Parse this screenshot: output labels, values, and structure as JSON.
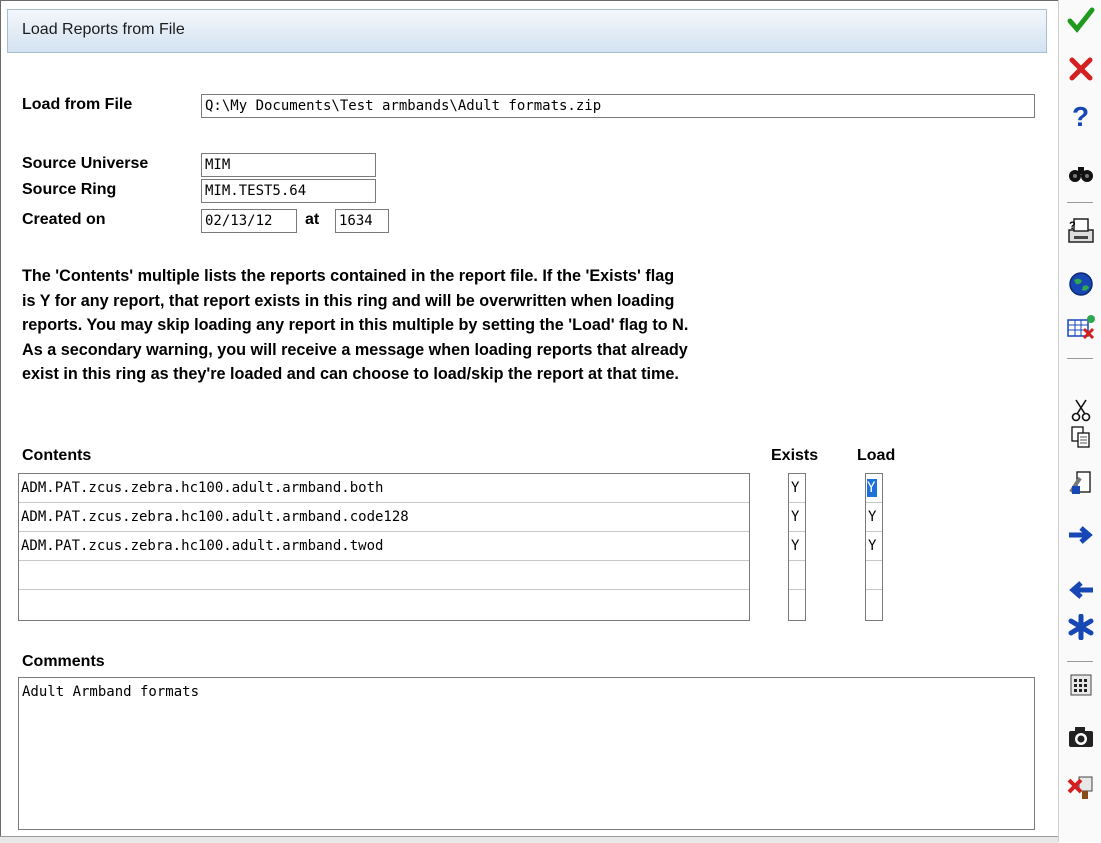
{
  "window": {
    "title": "Load Reports from File"
  },
  "form": {
    "load_from_file_label": "Load from File",
    "load_from_file_value": "Q:\\My Documents\\Test armbands\\Adult formats.zip",
    "source_universe_label": "Source Universe",
    "source_universe_value": "MIM",
    "source_ring_label": "Source Ring",
    "source_ring_value": "MIM.TEST5.64",
    "created_on_label": "Created on",
    "created_on_date": "02/13/12",
    "at_label": "at",
    "created_on_time": "1634"
  },
  "description": [
    "The 'Contents' multiple lists the reports contained in the report file. If the 'Exists' flag",
    "is Y for any report, that report exists in this ring and will be overwritten when loading",
    "reports. You may skip loading any report in this multiple by setting the 'Load' flag to N.",
    "As a secondary warning, you will receive a message when loading reports that already",
    "exist in this ring as they're loaded and can choose to load/skip the report at that time."
  ],
  "contents": {
    "header": "Contents",
    "exists_header": "Exists",
    "load_header": "Load",
    "rows": [
      {
        "name": "ADM.PAT.zcus.zebra.hc100.adult.armband.both",
        "exists": "Y",
        "load": "Y"
      },
      {
        "name": "ADM.PAT.zcus.zebra.hc100.adult.armband.code128",
        "exists": "Y",
        "load": "Y"
      },
      {
        "name": "ADM.PAT.zcus.zebra.hc100.adult.armband.twod",
        "exists": "Y",
        "load": "Y"
      },
      {
        "name": "",
        "exists": "",
        "load": ""
      },
      {
        "name": "",
        "exists": "",
        "load": ""
      }
    ]
  },
  "comments": {
    "header": "Comments",
    "value": "Adult Armband formats"
  },
  "toolbar": {
    "icons": [
      "check-icon",
      "cancel-x-icon",
      "help-icon",
      "binoculars-icon",
      "print-icon",
      "globe-icon",
      "table-icon",
      "cut-icon",
      "copy-icon",
      "paste-icon",
      "arrow-right-icon",
      "arrow-left-icon",
      "asterisk-icon",
      "keypad-icon",
      "camera-icon",
      "exit-icon"
    ],
    "colors": {
      "check": "#1f9a1f",
      "cancel": "#d42020",
      "blue": "#1747b5"
    }
  }
}
